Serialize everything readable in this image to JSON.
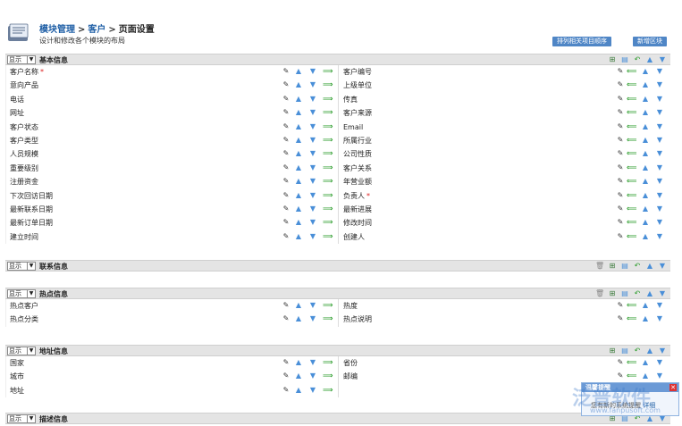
{
  "header": {
    "breadcrumb": [
      "模块管理",
      "客户",
      "页面设置"
    ],
    "separator": ">",
    "subtitle": "设计和修改各个模块的布局",
    "buttons": [
      "排列相关项目顺序",
      "新增区块"
    ]
  },
  "visibility_option": "显示",
  "sections": [
    {
      "title": "基本信息",
      "rows": [
        {
          "left": "客户名称",
          "left_required": true,
          "right": "客户编号",
          "right_required": false
        },
        {
          "left": "意向产品",
          "right": "上级单位"
        },
        {
          "left": "电话",
          "right": "传真"
        },
        {
          "left": "网址",
          "right": "客户来源"
        },
        {
          "left": "客户状态",
          "right": "Email"
        },
        {
          "left": "客户类型",
          "right": "所属行业"
        },
        {
          "left": "人员规模",
          "right": "公司性质"
        },
        {
          "left": "重要级别",
          "right": "客户关系"
        },
        {
          "left": "注册资金",
          "right": "年营业额"
        },
        {
          "left": "下次回访日期",
          "right": "负责人",
          "right_required": true
        },
        {
          "left": "最新联系日期",
          "right": "最新进展"
        },
        {
          "left": "最新订单日期",
          "right": "修改时间"
        },
        {
          "left": "建立时间",
          "right": "创建人"
        }
      ]
    },
    {
      "title": "联系信息",
      "rows": []
    },
    {
      "title": "热点信息",
      "rows": [
        {
          "left": "热点客户",
          "right": "热度"
        },
        {
          "left": "热点分类",
          "right": "热点说明"
        }
      ]
    },
    {
      "title": "地址信息",
      "rows": [
        {
          "left": "国家",
          "right": "省份"
        },
        {
          "left": "城市",
          "right": "邮编"
        },
        {
          "left": "地址",
          "right": ""
        }
      ]
    },
    {
      "title": "描述信息",
      "rows": []
    }
  ],
  "popup": {
    "title": "温馨提醒",
    "close": "✕",
    "body": "您有新的系统提醒",
    "link": "详细"
  },
  "watermark": {
    "text": "泛普软件",
    "url": "www.fanpusoft.com"
  },
  "colors": {
    "accent": "#1f5fa6",
    "button": "#4f86c6",
    "section_bar": "#e4e4e4",
    "arrow_blue": "#4a8fd8",
    "arrow_green": "#2e9e2e"
  },
  "icons": {
    "edit": "edit-icon",
    "up": "arrow-up-icon",
    "down": "arrow-down-icon",
    "move_right": "arrow-right-icon",
    "move_left": "arrow-left-icon"
  }
}
